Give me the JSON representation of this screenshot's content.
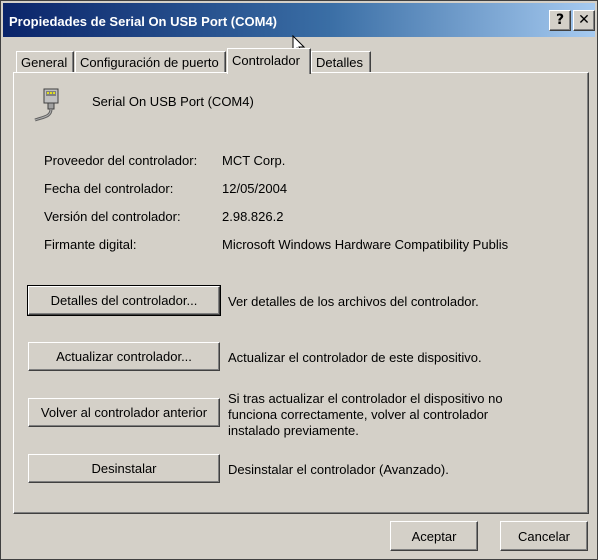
{
  "window": {
    "title": "Propiedades de Serial On USB Port (COM4)",
    "help_glyph": "?",
    "close_glyph": "✕"
  },
  "tabs": [
    {
      "label": "General",
      "active": false
    },
    {
      "label": "Configuración de puerto",
      "active": false
    },
    {
      "label": "Controlador",
      "active": true
    },
    {
      "label": "Detalles",
      "active": false
    }
  ],
  "device": {
    "icon": "serial-port-icon",
    "name": "Serial On USB Port (COM4)"
  },
  "driver_info": [
    {
      "label": "Proveedor del controlador:",
      "value": "MCT Corp."
    },
    {
      "label": "Fecha del controlador:",
      "value": "12/05/2004"
    },
    {
      "label": "Versión del controlador:",
      "value": "2.98.826.2"
    },
    {
      "label": "Firmante digital:",
      "value": "Microsoft Windows Hardware Compatibility Publis"
    }
  ],
  "actions": [
    {
      "button": "Detalles del controlador...",
      "description": "Ver detalles de los archivos del controlador."
    },
    {
      "button": "Actualizar controlador...",
      "description": "Actualizar el controlador de este dispositivo."
    },
    {
      "button": "Volver al controlador anterior",
      "description": "Si tras actualizar el controlador el dispositivo no funciona correctamente, volver al controlador instalado previamente."
    },
    {
      "button": "Desinstalar",
      "description": "Desinstalar el controlador (Avanzado)."
    }
  ],
  "footer": {
    "ok_label": "Aceptar",
    "cancel_label": "Cancelar"
  },
  "colors": {
    "face": "#d4d0c8",
    "title_start": "#0a246a",
    "title_end": "#a6caf0"
  }
}
